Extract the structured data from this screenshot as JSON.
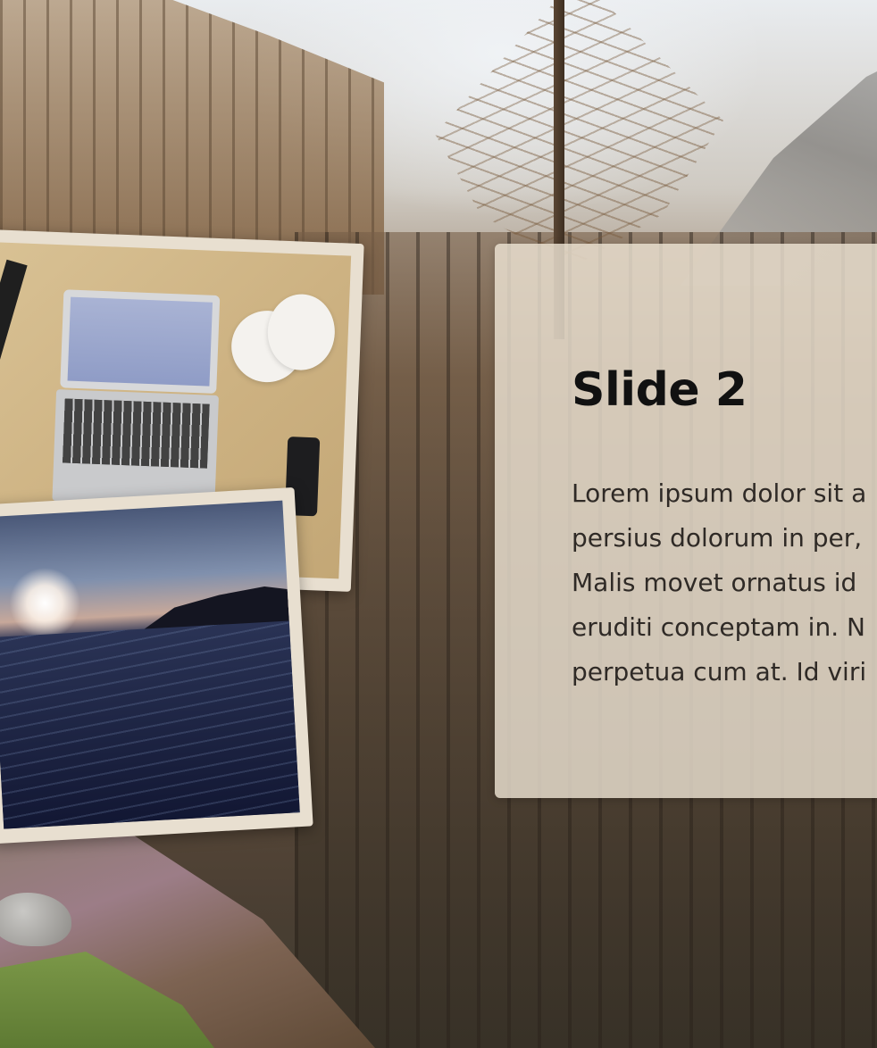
{
  "slide": {
    "title": "Slide 2",
    "body_lines": [
      "Lorem ipsum dolor sit a",
      "persius dolorum in per,",
      "Malis movet ornatus id",
      "eruditi conceptam in. N",
      "perpetua cum at. Id viri"
    ]
  },
  "images": {
    "background": "misty-forest-photo",
    "photo_1": "desk-laptop-photo",
    "photo_2": "sea-sunset-photo"
  },
  "colors": {
    "card_background": "#ece2d2",
    "title_text": "#111111",
    "body_text": "#2f2a26",
    "photo_frame": "#e8dfd0"
  }
}
